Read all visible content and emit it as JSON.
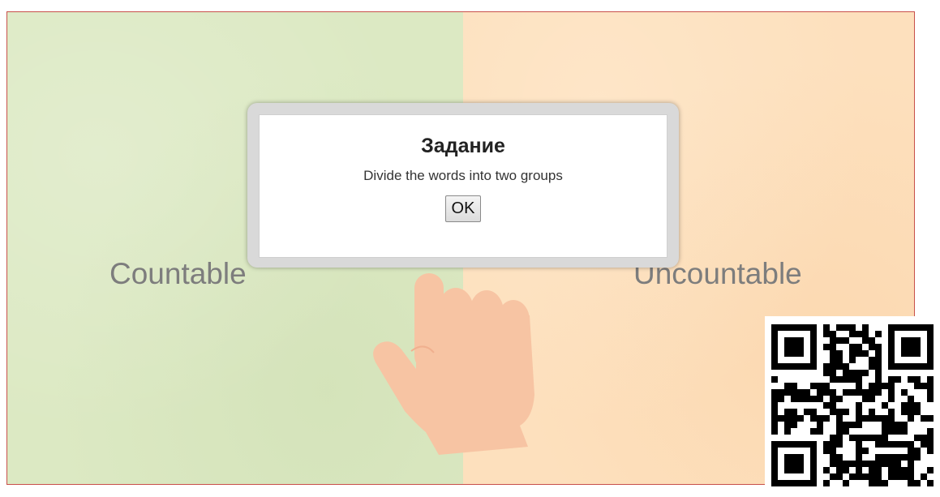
{
  "zones": {
    "left_label": "Countable",
    "right_label": "Uncountable",
    "left_color": "#dce9c3",
    "right_color": "#fde0bd"
  },
  "dialog": {
    "title": "Задание",
    "message": "Divide the words into two groups",
    "ok_label": "OK"
  },
  "icons": {
    "hand": "pointing-hand-icon",
    "qr": "qr-code"
  }
}
